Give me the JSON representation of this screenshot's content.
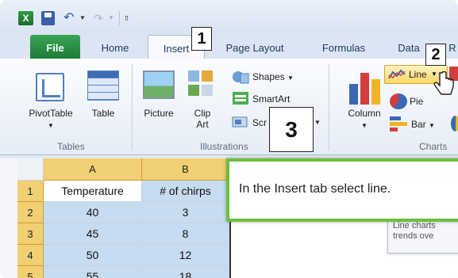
{
  "qat": {
    "app_letter": "X",
    "customize_glyph": "⫪"
  },
  "tabs": [
    "File",
    "Home",
    "Insert",
    "Page Layout",
    "Formulas",
    "Data",
    "R"
  ],
  "ribbon": {
    "pivottable_label": "PivotTable",
    "table_label": "Table",
    "picture_label": "Picture",
    "clipart_label": "Clip\nArt",
    "shapes_label": "Shapes",
    "smartart_label": "SmartArt",
    "screenshot_label": "Scr",
    "column_label": "Column",
    "line_label": "Line",
    "pie_label": "Pie",
    "bar_label": "Bar",
    "groups": {
      "tables": "Tables",
      "illustrations": "Illustrations",
      "charts": "Charts"
    }
  },
  "grid": {
    "columns": [
      "A",
      "B"
    ],
    "rows": [
      "1",
      "2",
      "3",
      "4",
      "5"
    ],
    "header": [
      "Temperature",
      "# of chirps"
    ],
    "data": [
      [
        "40",
        "3"
      ],
      [
        "45",
        "8"
      ],
      [
        "50",
        "12"
      ],
      [
        "55",
        "18"
      ]
    ]
  },
  "callouts": {
    "step1": "1",
    "step2": "2",
    "step3": "3",
    "instruction": "In the Insert tab select line."
  },
  "screentip": {
    "line1": "Line charts",
    "line2": "trends ove"
  },
  "colors": {
    "file_tab": "#1e7a36",
    "callout_border": "#6cbf3c",
    "selected_cells": "#c7dbf1",
    "header_highlight": "#f1cf73"
  }
}
